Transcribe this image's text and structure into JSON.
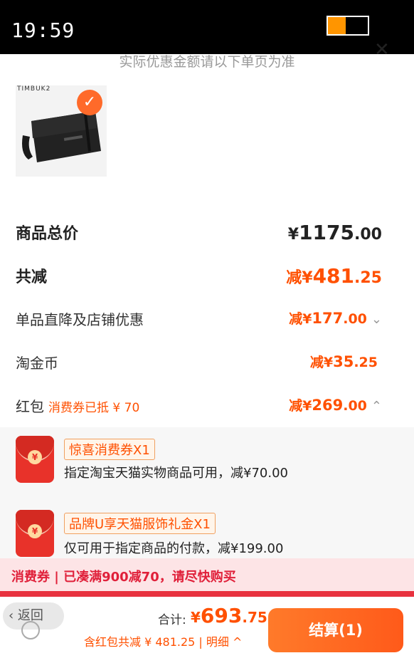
{
  "status_bar": {
    "time": "19:59",
    "battery_level": 0.45,
    "battery_color": "#ff9500"
  },
  "header": {
    "hint": "实际优惠金额请以下单页为准",
    "close_icon": "close-icon"
  },
  "product": {
    "brand_text": "TIMBUK2",
    "selected": true
  },
  "summary": {
    "total": {
      "label": "商品总价",
      "currency": "¥",
      "main": "1175",
      "dec": ".00"
    },
    "discount": {
      "label": "共减",
      "prefix": "减¥",
      "main": "481",
      "dec": ".25"
    },
    "items": [
      {
        "label": "单品直降及店铺优惠",
        "sub": "",
        "prefix": "减¥",
        "main": "177",
        "dec": ".00",
        "chevron": "chevron-down-icon"
      },
      {
        "label": "淘金币",
        "sub": "",
        "prefix": "减¥",
        "main": "35",
        "dec": ".25",
        "chevron": ""
      },
      {
        "label": "红包",
        "sub": "消费券已抵 ¥ 70",
        "prefix": "减¥",
        "main": "269",
        "dec": ".00",
        "chevron": "chevron-up-icon"
      }
    ]
  },
  "coupons": [
    {
      "tag": "惊喜消费券X1",
      "desc": "指定淘宝天猫实物商品可用，减¥70.00"
    },
    {
      "tag": "品牌U享天猫服饰礼金X1",
      "desc": "仅可用于指定商品的付款，减¥199.00"
    }
  ],
  "promo": {
    "text": "消费券 | 已凑满900减70，请尽快购买"
  },
  "bottom": {
    "back_label": "返回",
    "total_label": "合计:",
    "total_symbol": "¥",
    "total_main": "693",
    "total_dec": ".75",
    "total_sub": "含红包共减 ¥ 481.25 | 明细",
    "checkout_label": "结算(1)"
  },
  "colors": {
    "accent": "#ff5000",
    "promo_bg": "#fde4e6",
    "promo_text": "#e0203a"
  }
}
